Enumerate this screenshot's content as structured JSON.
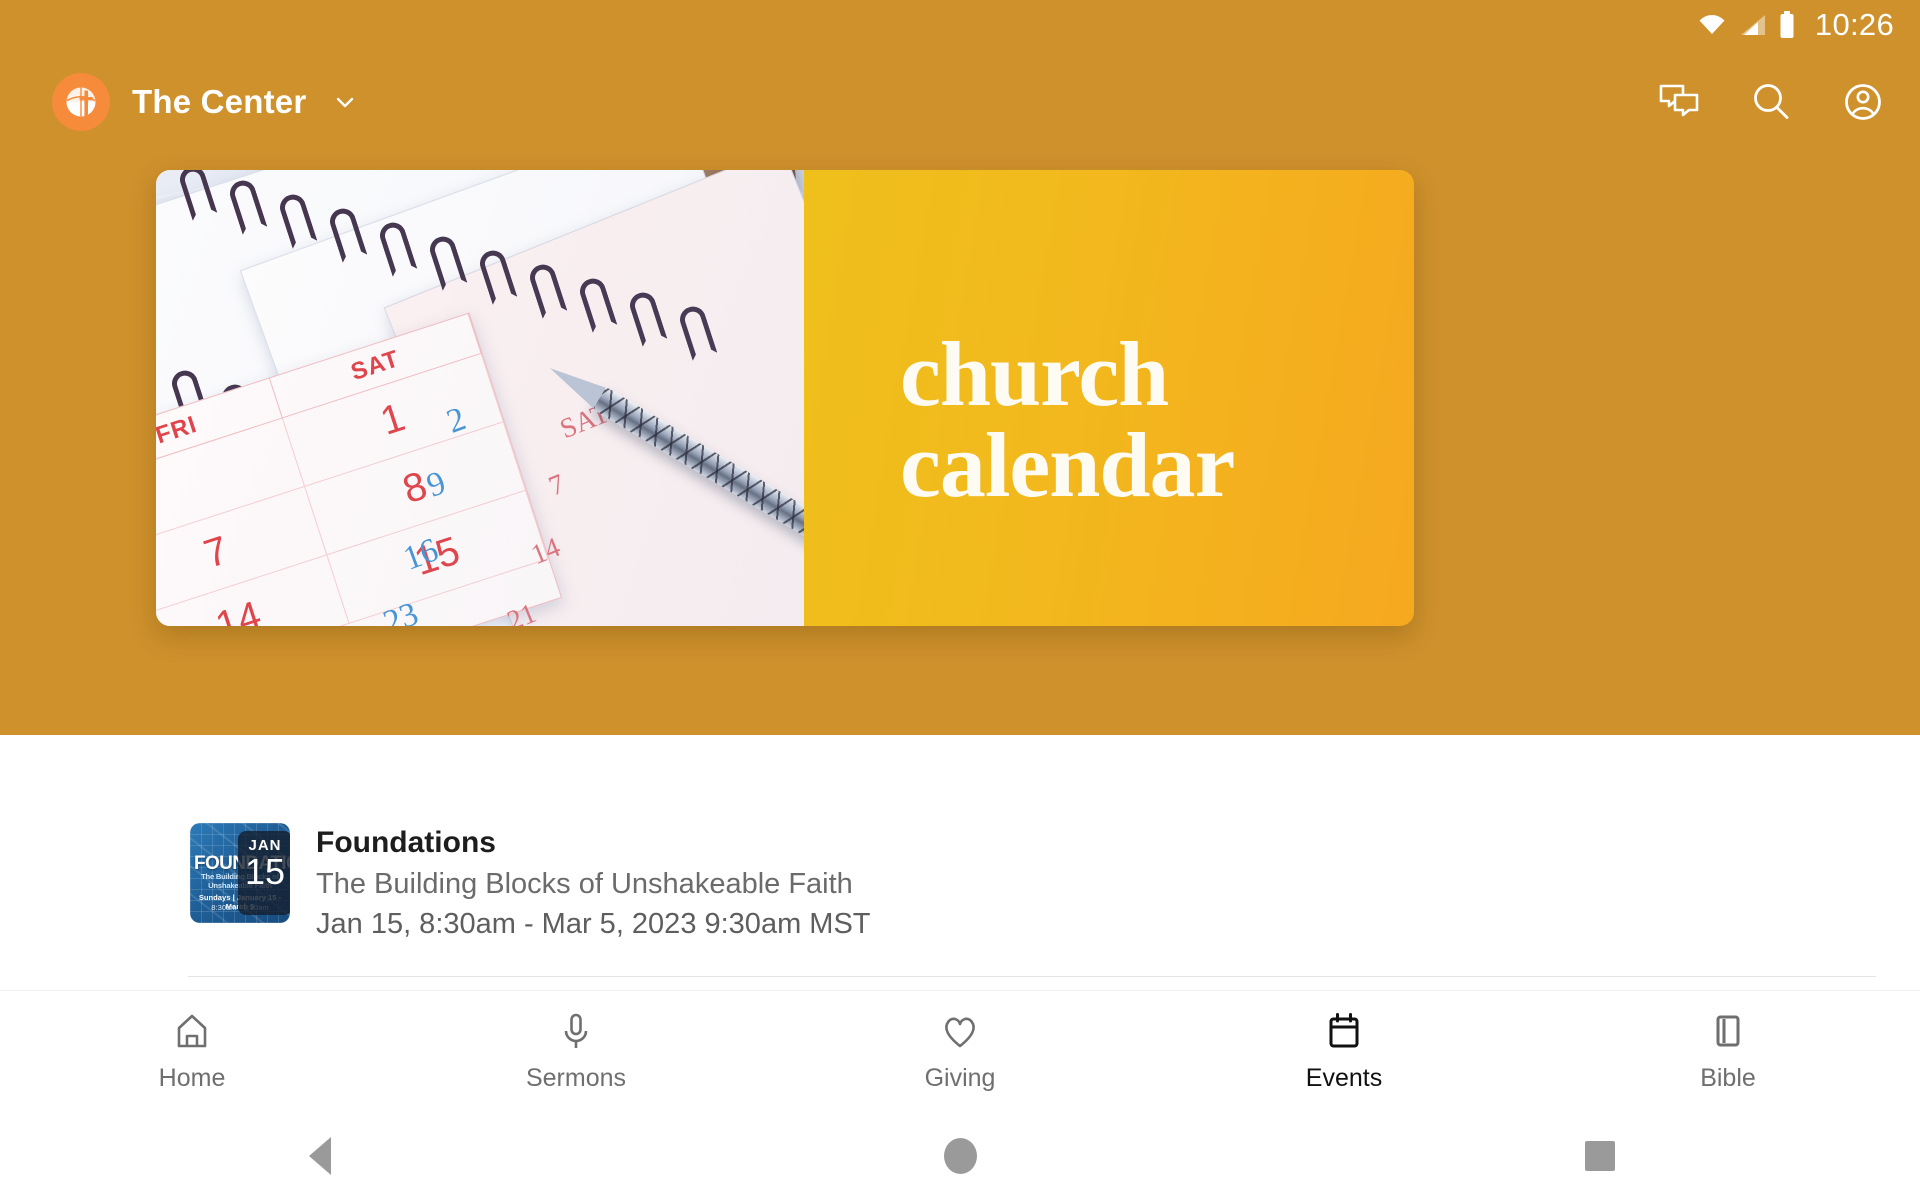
{
  "status_bar": {
    "time": "10:26",
    "icons": [
      "wifi-icon",
      "cellular-signal-icon",
      "battery-icon"
    ]
  },
  "app_bar": {
    "brand_name": "The Center",
    "logo_icon": "church-globe-cross-logo",
    "caret_icon": "chevron-down-icon",
    "actions": [
      {
        "name": "messages-icon",
        "label": "Messages"
      },
      {
        "name": "search-icon",
        "label": "Search"
      },
      {
        "name": "account-icon",
        "label": "Account"
      }
    ]
  },
  "banner": {
    "title": "church\ncalendar",
    "photo_alt": "desk-calendars-and-pen-photo",
    "gradient_from": "#EFC01C",
    "gradient_to": "#F6A81F"
  },
  "events": [
    {
      "title": "Foundations",
      "subtitle": "The Building Blocks of Unshakeable Faith",
      "date_range": "Jan 15, 8:30am - Mar 5, 2023 9:30am MST",
      "thumb": {
        "word": "FOUNDATIONS",
        "tagline": "The Building Blocks of Unshakeable Faith",
        "when": "Sundays | January 15 - March 5",
        "when2": "8:30am - 9:30am",
        "badge_month": "JAN",
        "badge_day": "15"
      }
    }
  ],
  "tabs": [
    {
      "label": "Home",
      "icon": "home-icon",
      "active": false
    },
    {
      "label": "Sermons",
      "icon": "mic-icon",
      "active": false
    },
    {
      "label": "Giving",
      "icon": "heart-icon",
      "active": false
    },
    {
      "label": "Events",
      "icon": "calendar-icon",
      "active": true
    },
    {
      "label": "Bible",
      "icon": "book-icon",
      "active": false
    }
  ],
  "system_nav": {
    "back": "back-triangle-icon",
    "home": "home-circle-icon",
    "recents": "recents-square-icon"
  },
  "colors": {
    "header_bg": "#CE912C",
    "logo_bg": "#F68B3C",
    "accent_yellow": "#EFC01C",
    "accent_orange": "#F6A81F"
  }
}
